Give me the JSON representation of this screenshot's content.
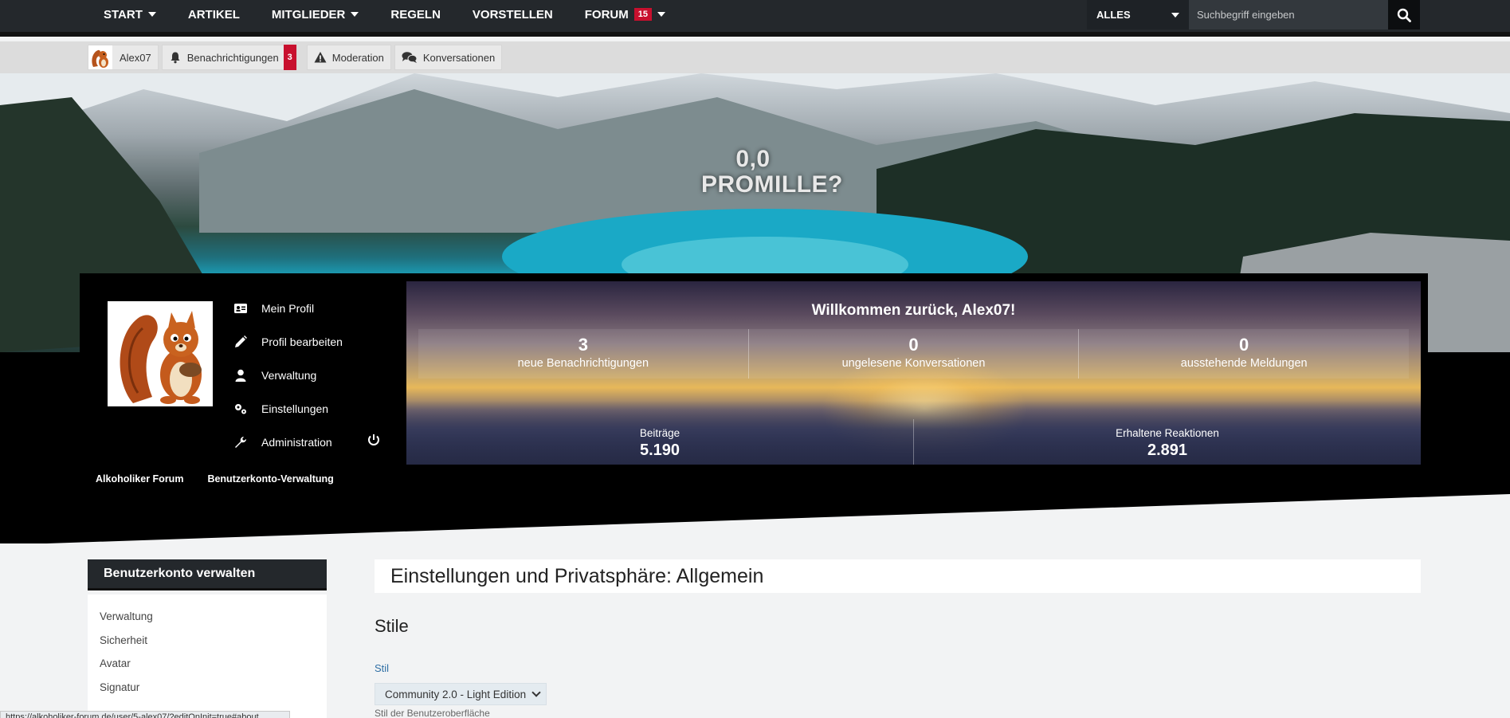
{
  "topnav": {
    "items": [
      {
        "label": "START",
        "caret": true
      },
      {
        "label": "ARTIKEL",
        "caret": false
      },
      {
        "label": "MITGLIEDER",
        "caret": true
      },
      {
        "label": "REGELN",
        "caret": false
      },
      {
        "label": "VORSTELLEN",
        "caret": false
      },
      {
        "label": "FORUM",
        "caret": true,
        "badge": "15"
      }
    ],
    "search_scope": "ALLES",
    "search_placeholder": "Suchbegriff eingeben"
  },
  "userbar": {
    "username": "Alex07",
    "notifications_label": "Benachrichtigungen",
    "notifications_count": "3",
    "moderation_label": "Moderation",
    "conversations_label": "Konversationen"
  },
  "hero": {
    "slogan_line1": "0,0",
    "slogan_line2": "PROMILLE?"
  },
  "dashboard": {
    "menu": {
      "my_profile": "Mein Profil",
      "edit_profile": "Profil bearbeiten",
      "management": "Verwaltung",
      "settings": "Einstellungen",
      "administration": "Administration"
    },
    "breadcrumbs": [
      "Alkoholiker Forum",
      "Benutzerkonto-Verwaltung"
    ],
    "welcome": "Willkommen zurück, Alex07!",
    "stats_top": [
      {
        "value": "3",
        "label": "neue Benachrichtigungen"
      },
      {
        "value": "0",
        "label": "ungelesene Konversationen"
      },
      {
        "value": "0",
        "label": "ausstehende Meldungen"
      }
    ],
    "stats_bottom": [
      {
        "label": "Beiträge",
        "value": "5.190"
      },
      {
        "label": "Erhaltene Reaktionen",
        "value": "2.891"
      }
    ]
  },
  "sidebar": {
    "title": "Benutzerkonto verwalten",
    "items": [
      "Verwaltung",
      "Sicherheit",
      "Avatar",
      "Signatur"
    ]
  },
  "content": {
    "page_title": "Einstellungen und Privatsphäre: Allgemein",
    "section_title": "Stile",
    "style_label": "Stil",
    "style_value": "Community 2.0 - Light Edition",
    "style_desc": "Stil der Benutzeroberfläche"
  },
  "statusbar": {
    "url": "https://alkoholiker-forum.de/user/5-alex07/?editOnInit=true#about"
  },
  "colors": {
    "nav_bg": "#24282c",
    "badge_red": "#c8102e",
    "link_blue": "#2f6fa5"
  }
}
